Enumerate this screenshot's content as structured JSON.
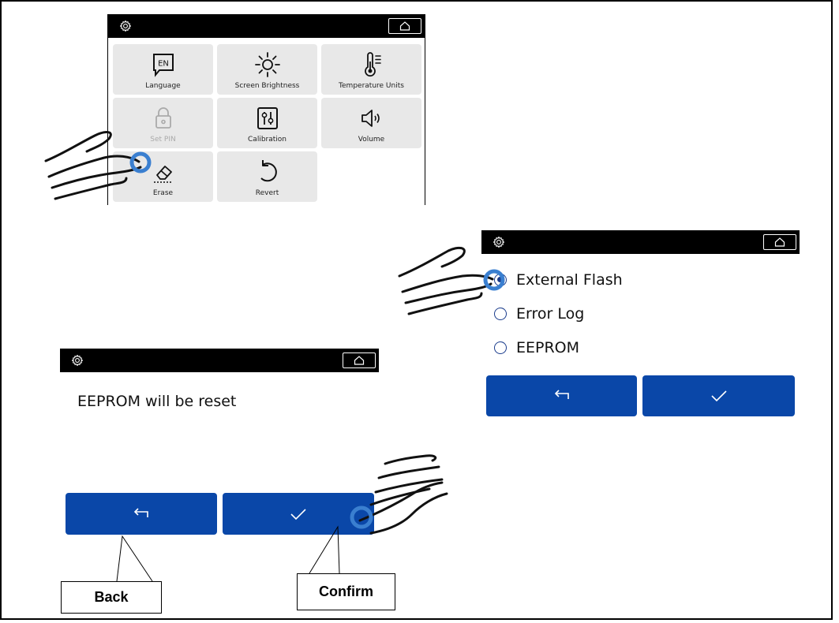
{
  "settings_screen": {
    "tiles": [
      {
        "label": "Language",
        "icon": "language-en-icon",
        "badge": "EN",
        "enabled": true
      },
      {
        "label": "Screen Brightness",
        "icon": "brightness-icon",
        "enabled": true
      },
      {
        "label": "Temperature Units",
        "icon": "thermometer-icon",
        "enabled": true
      },
      {
        "label": "Set PIN",
        "icon": "lock-icon",
        "enabled": false
      },
      {
        "label": "Calibration",
        "icon": "calibration-icon",
        "enabled": true
      },
      {
        "label": "Volume",
        "icon": "speaker-icon",
        "enabled": true
      },
      {
        "label": "Erase",
        "icon": "eraser-icon",
        "enabled": true
      },
      {
        "label": "Revert",
        "icon": "revert-icon",
        "enabled": true
      }
    ]
  },
  "erase_screen": {
    "options": [
      {
        "label": "External Flash",
        "selected": true
      },
      {
        "label": "Error Log",
        "selected": false
      },
      {
        "label": "EEPROM",
        "selected": false
      }
    ]
  },
  "confirm_screen": {
    "message": "EEPROM will be reset"
  },
  "callouts": {
    "back": "Back",
    "confirm": "Confirm"
  },
  "colors": {
    "button_blue": "#0a47a8",
    "touch_ring": "#3a7fd0",
    "tile_bg": "#e8e8e8"
  }
}
